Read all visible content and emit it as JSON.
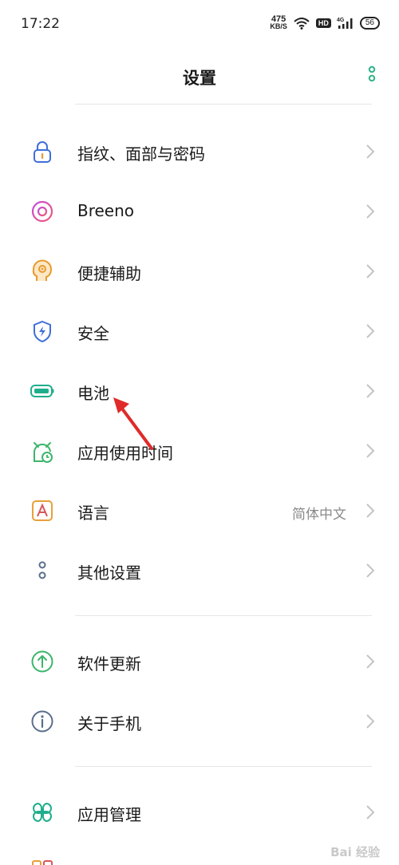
{
  "status": {
    "time": "17:22",
    "net_speed": "475",
    "net_unit": "KB/S",
    "hd": "HD",
    "signal": "4G",
    "battery": "56"
  },
  "header": {
    "title": "设置"
  },
  "items": [
    {
      "label": "指纹、面部与密码",
      "icon": "lock-icon"
    },
    {
      "label": "Breeno",
      "icon": "breeno-icon"
    },
    {
      "label": "便捷辅助",
      "icon": "head-assist-icon"
    },
    {
      "label": "安全",
      "icon": "shield-bolt-icon"
    },
    {
      "label": "电池",
      "icon": "battery-icon"
    },
    {
      "label": "应用使用时间",
      "icon": "clock-timer-icon"
    },
    {
      "label": "语言",
      "value": "简体中文",
      "icon": "language-a-icon"
    },
    {
      "label": "其他设置",
      "icon": "dots-icon"
    },
    {
      "label": "软件更新",
      "icon": "update-arrow-icon"
    },
    {
      "label": "关于手机",
      "icon": "info-icon"
    },
    {
      "label": "应用管理",
      "icon": "app-grid-icon"
    }
  ],
  "colors": {
    "accent_green": "#2fb38a",
    "annotation_red": "#e02a2a"
  },
  "watermark": "Bai 经验"
}
